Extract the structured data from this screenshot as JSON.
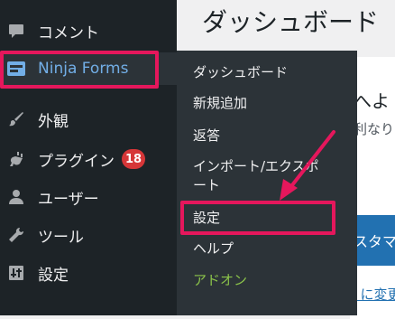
{
  "page": {
    "title": "ダッシュボード"
  },
  "content": {
    "heading_fragment": "へよ",
    "subtext_fragment": "利なり",
    "button_fragment": "スタマ",
    "link_fragment": "ﾞに変更"
  },
  "sidebar": {
    "items": [
      {
        "label": "コメント",
        "icon": "comment-icon"
      },
      {
        "label": "Ninja Forms",
        "icon": "ninja-forms-icon",
        "active": true
      },
      {
        "label": "外観",
        "icon": "paint-brush-icon"
      },
      {
        "label": "プラグイン",
        "icon": "plugin-icon",
        "badge": "18"
      },
      {
        "label": "ユーザー",
        "icon": "user-icon"
      },
      {
        "label": "ツール",
        "icon": "wrench-icon"
      },
      {
        "label": "設定",
        "icon": "settings-icon"
      }
    ]
  },
  "submenu": {
    "items": [
      {
        "label": "ダッシュボード"
      },
      {
        "label": "新規追加"
      },
      {
        "label": "返答"
      },
      {
        "label": "インポート/エクスポ\nート"
      },
      {
        "label": "設定",
        "highlighted": true
      },
      {
        "label": "ヘルプ"
      },
      {
        "label": "アドオン"
      }
    ]
  },
  "colors": {
    "sidebar_bg": "#1d2327",
    "flyout_bg": "#2c3338",
    "accent": "#72aee6",
    "highlight": "#e5175c",
    "badge": "#d63638",
    "addon": "#8bc34a"
  }
}
